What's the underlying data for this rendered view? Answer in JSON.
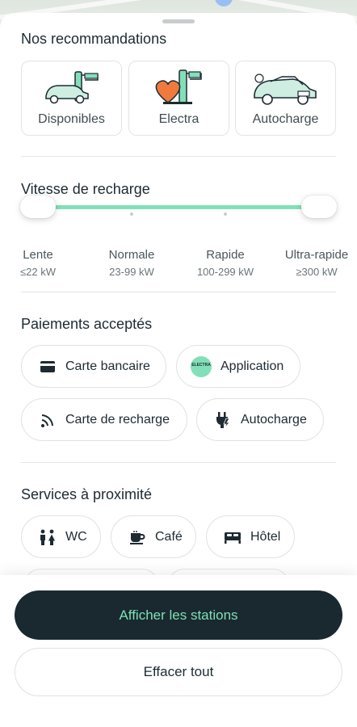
{
  "recommendations": {
    "title": "Nos recommandations",
    "items": [
      {
        "label": "Disponibles",
        "icon": "car-at-charger-icon"
      },
      {
        "label": "Electra",
        "icon": "heart-charger-icon"
      },
      {
        "label": "Autocharge",
        "icon": "car-icon"
      }
    ]
  },
  "speed": {
    "title": "Vitesse de recharge",
    "selected_range": [
      "Lente",
      "Ultra-rapide"
    ],
    "levels": [
      {
        "name": "Lente",
        "range": "≤22 kW"
      },
      {
        "name": "Normale",
        "range": "23-99 kW"
      },
      {
        "name": "Rapide",
        "range": "100-299 kW"
      },
      {
        "name": "Ultra-rapide",
        "range": "≥300 kW"
      }
    ]
  },
  "payments": {
    "title": "Paiements acceptés",
    "options": [
      {
        "label": "Carte bancaire",
        "icon": "credit-card-icon"
      },
      {
        "label": "Application",
        "icon": "electra-logo-icon",
        "badge": "ELECTRA"
      },
      {
        "label": "Carte de recharge",
        "icon": "contactless-icon"
      },
      {
        "label": "Autocharge",
        "icon": "plug-charge-icon"
      }
    ]
  },
  "services": {
    "title": "Services à proximité",
    "options": [
      {
        "label": "WC",
        "icon": "restroom-icon"
      },
      {
        "label": "Café",
        "icon": "coffee-icon"
      },
      {
        "label": "Hôtel",
        "icon": "bed-icon"
      }
    ]
  },
  "actions": {
    "primary": "Afficher les stations",
    "secondary": "Effacer tout"
  },
  "colors": {
    "accent": "#82e0b8",
    "primary_button": "#19292f",
    "primary_button_text": "#7fe0b5"
  }
}
